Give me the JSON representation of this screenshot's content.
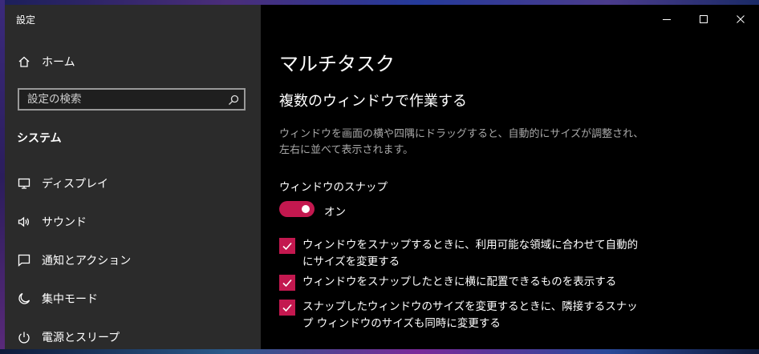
{
  "window": {
    "title": "設定"
  },
  "sidebar": {
    "home_label": "ホーム",
    "search_placeholder": "設定の検索",
    "section_heading": "システム",
    "items": [
      {
        "label": "ディスプレイ",
        "icon": "monitor-icon"
      },
      {
        "label": "サウンド",
        "icon": "speaker-icon"
      },
      {
        "label": "通知とアクション",
        "icon": "notification-icon"
      },
      {
        "label": "集中モード",
        "icon": "moon-icon"
      },
      {
        "label": "電源とスリープ",
        "icon": "power-icon"
      }
    ]
  },
  "main": {
    "page_title": "マルチタスク",
    "subtitle": "複数のウィンドウで作業する",
    "description": "ウィンドウを画面の横や四隅にドラッグすると、自動的にサイズが調整され、左右に並べて表示されます。",
    "snap_label": "ウィンドウのスナップ",
    "snap_toggle": {
      "state_label": "オン",
      "on": true
    },
    "options": [
      {
        "label": "ウィンドウをスナップするときに、利用可能な領域に合わせて自動的にサイズを変更する",
        "checked": true
      },
      {
        "label": "ウィンドウをスナップしたときに横に配置できるものを表示する",
        "checked": true
      },
      {
        "label": "スナップしたウィンドウのサイズを変更するときに、隣接するスナップ ウィンドウのサイズも同時に変更する",
        "checked": true
      }
    ]
  },
  "colors": {
    "accent": "#c3184f",
    "sidebar_bg": "#2b2b2b",
    "main_bg": "#000000",
    "description_text": "#a8a8a8"
  }
}
